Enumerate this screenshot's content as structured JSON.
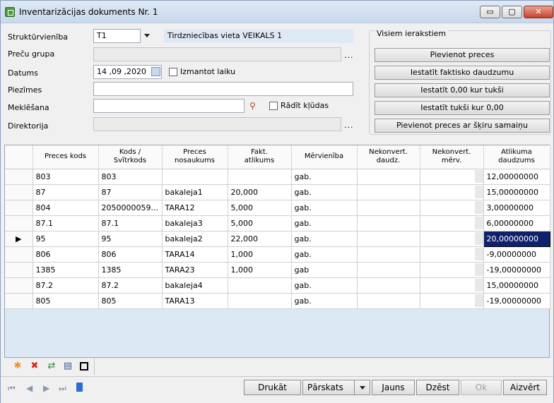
{
  "window": {
    "title": "Inventarizācijas dokuments Nr. 1",
    "minimize": "▭",
    "maximize": "▢",
    "close": "✕"
  },
  "form": {
    "struktura_label": "Struktūrvienība",
    "struktura_value": "T1",
    "struktura_name": "Tirdzniecības vieta VEIKALS 1",
    "precu_grupa_label": "Preču grupa",
    "precu_grupa_value": "",
    "ellipsis": "...",
    "datums_label": "Datums",
    "datums_value": "14 ,09 ,2020",
    "izmantot_laiku_label": "Izmantot laiku",
    "piezimes_label": "Piezīmes",
    "piezimes_value": "",
    "meklesana_label": "Meklēšana",
    "meklesana_value": "",
    "radit_kludas_label": "Rādīt kļūdas",
    "direktorija_label": "Direktorija",
    "direktorija_value": ""
  },
  "actions": {
    "group_title": "Visiem ierakstiem",
    "buttons": [
      "Pievienot preces",
      "Iestatīt faktisko daudzumu",
      "Iestatīt 0,00 kur tukši",
      "Iestatīt tukši kur 0,00",
      "Pievienot preces ar šķiru samaiņu"
    ]
  },
  "grid": {
    "columns": [
      "Preces kods",
      "Kods /\nSvītrkods",
      "Preces\nnosaukums",
      "Fakt.\natlikums",
      "Mērvienība",
      "Nekonvert.\ndaudz.",
      "Nekonvert.\nmērv.",
      "Atlikuma\ndaudzums"
    ],
    "current_row_marker": "▶",
    "rows": [
      [
        "803",
        "803",
        "",
        "",
        "gab.",
        "",
        "",
        "12,00000000"
      ],
      [
        "87",
        "87",
        "bakaleja1",
        "20,000",
        "gab.",
        "",
        "",
        "15,00000000"
      ],
      [
        "804",
        "2050000059...",
        "TARA12",
        "5,000",
        "gab.",
        "",
        "",
        "3,00000000"
      ],
      [
        "87.1",
        "87.1",
        "bakaleja3",
        "5,000",
        "gab.",
        "",
        "",
        "6,00000000"
      ],
      [
        "95",
        "95",
        "bakaleja2",
        "22,000",
        "gab.",
        "",
        "",
        "20,00000000"
      ],
      [
        "806",
        "806",
        "TARA14",
        "1,000",
        "gab.",
        "",
        "",
        "-9,00000000"
      ],
      [
        "1385",
        "1385",
        "TARA23",
        "1,000",
        "gab",
        "",
        "",
        "-19,00000000"
      ],
      [
        "87.2",
        "87.2",
        "bakaleja4",
        "",
        "gab.",
        "",
        "",
        "15,00000000"
      ],
      [
        "805",
        "805",
        "TARA13",
        "",
        "gab.",
        "",
        "",
        "-19,00000000"
      ]
    ],
    "selected_row": 4
  },
  "toolbar": {
    "icons": [
      "add-icon",
      "delete-icon",
      "refresh-icon",
      "document-icon",
      "square-icon"
    ]
  },
  "navigation": {
    "first": "⏮",
    "prev": "◀",
    "next": "▶",
    "last": "⏭"
  },
  "bottom_buttons": {
    "print": "Drukāt",
    "reports": "Pārskats",
    "new": "Jauns",
    "delete": "Dzēst",
    "ok": "Ok",
    "close": "Aizvērt"
  }
}
